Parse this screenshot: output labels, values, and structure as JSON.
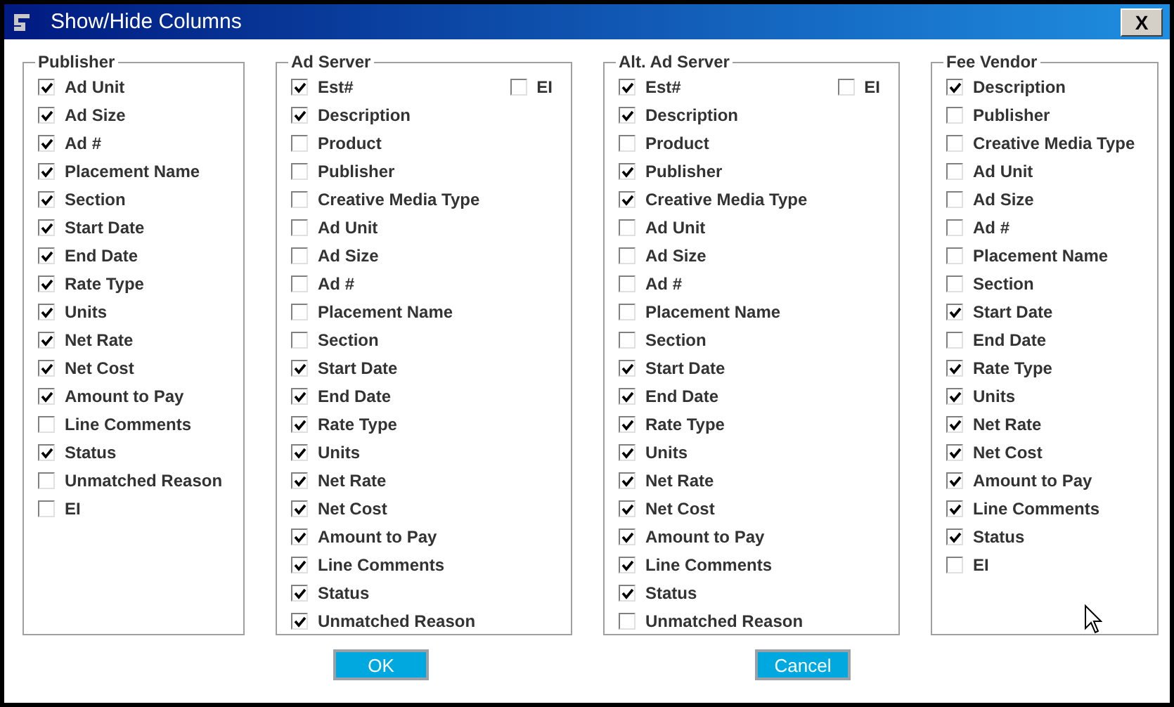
{
  "window": {
    "title": "Show/Hide Columns",
    "close": "X"
  },
  "groups": [
    {
      "title": "Publisher",
      "items": [
        {
          "label": "Ad Unit",
          "checked": true
        },
        {
          "label": "Ad Size",
          "checked": true
        },
        {
          "label": "Ad #",
          "checked": true
        },
        {
          "label": "Placement Name",
          "checked": true
        },
        {
          "label": "Section",
          "checked": true
        },
        {
          "label": "Start Date",
          "checked": true
        },
        {
          "label": "End Date",
          "checked": true
        },
        {
          "label": "Rate Type",
          "checked": true
        },
        {
          "label": "Units",
          "checked": true
        },
        {
          "label": "Net Rate",
          "checked": true
        },
        {
          "label": "Net Cost",
          "checked": true
        },
        {
          "label": "Amount to Pay",
          "checked": true
        },
        {
          "label": "Line Comments",
          "checked": false
        },
        {
          "label": "Status",
          "checked": true
        },
        {
          "label": "Unmatched Reason",
          "checked": false
        },
        {
          "label": "EI",
          "checked": false
        }
      ]
    },
    {
      "title": "Ad Server",
      "extra": {
        "label": "EI",
        "checked": false
      },
      "items": [
        {
          "label": "Est#",
          "checked": true
        },
        {
          "label": "Description",
          "checked": true
        },
        {
          "label": "Product",
          "checked": false
        },
        {
          "label": "Publisher",
          "checked": false
        },
        {
          "label": "Creative Media Type",
          "checked": false
        },
        {
          "label": "Ad Unit",
          "checked": false
        },
        {
          "label": "Ad Size",
          "checked": false
        },
        {
          "label": "Ad #",
          "checked": false
        },
        {
          "label": "Placement Name",
          "checked": false
        },
        {
          "label": "Section",
          "checked": false
        },
        {
          "label": "Start Date",
          "checked": true
        },
        {
          "label": "End Date",
          "checked": true
        },
        {
          "label": "Rate Type",
          "checked": true
        },
        {
          "label": "Units",
          "checked": true
        },
        {
          "label": "Net Rate",
          "checked": true
        },
        {
          "label": "Net Cost",
          "checked": true
        },
        {
          "label": "Amount to Pay",
          "checked": true
        },
        {
          "label": "Line Comments",
          "checked": true
        },
        {
          "label": "Status",
          "checked": true
        },
        {
          "label": "Unmatched Reason",
          "checked": true
        }
      ]
    },
    {
      "title": "Alt. Ad Server",
      "extra": {
        "label": "EI",
        "checked": false
      },
      "items": [
        {
          "label": "Est#",
          "checked": true
        },
        {
          "label": "Description",
          "checked": true
        },
        {
          "label": "Product",
          "checked": false
        },
        {
          "label": "Publisher",
          "checked": true
        },
        {
          "label": "Creative Media Type",
          "checked": true
        },
        {
          "label": "Ad Unit",
          "checked": false
        },
        {
          "label": "Ad Size",
          "checked": false
        },
        {
          "label": "Ad #",
          "checked": false
        },
        {
          "label": "Placement Name",
          "checked": false
        },
        {
          "label": "Section",
          "checked": false
        },
        {
          "label": "Start Date",
          "checked": true
        },
        {
          "label": "End Date",
          "checked": true
        },
        {
          "label": "Rate Type",
          "checked": true
        },
        {
          "label": "Units",
          "checked": true
        },
        {
          "label": "Net Rate",
          "checked": true
        },
        {
          "label": "Net Cost",
          "checked": true
        },
        {
          "label": "Amount to Pay",
          "checked": true
        },
        {
          "label": "Line Comments",
          "checked": true
        },
        {
          "label": "Status",
          "checked": true
        },
        {
          "label": "Unmatched Reason",
          "checked": false
        }
      ]
    },
    {
      "title": "Fee Vendor",
      "items": [
        {
          "label": "Description",
          "checked": true
        },
        {
          "label": "Publisher",
          "checked": false
        },
        {
          "label": "Creative Media Type",
          "checked": false
        },
        {
          "label": "Ad Unit",
          "checked": false
        },
        {
          "label": "Ad Size",
          "checked": false
        },
        {
          "label": "Ad #",
          "checked": false
        },
        {
          "label": "Placement Name",
          "checked": false
        },
        {
          "label": "Section",
          "checked": false
        },
        {
          "label": "Start Date",
          "checked": true
        },
        {
          "label": "End Date",
          "checked": false
        },
        {
          "label": "Rate Type",
          "checked": true
        },
        {
          "label": "Units",
          "checked": true
        },
        {
          "label": "Net Rate",
          "checked": true
        },
        {
          "label": "Net Cost",
          "checked": true
        },
        {
          "label": "Amount to Pay",
          "checked": true
        },
        {
          "label": "Line Comments",
          "checked": true
        },
        {
          "label": "Status",
          "checked": true
        },
        {
          "label": "EI",
          "checked": false
        }
      ]
    }
  ],
  "buttons": [
    "OK",
    "Cancel"
  ]
}
